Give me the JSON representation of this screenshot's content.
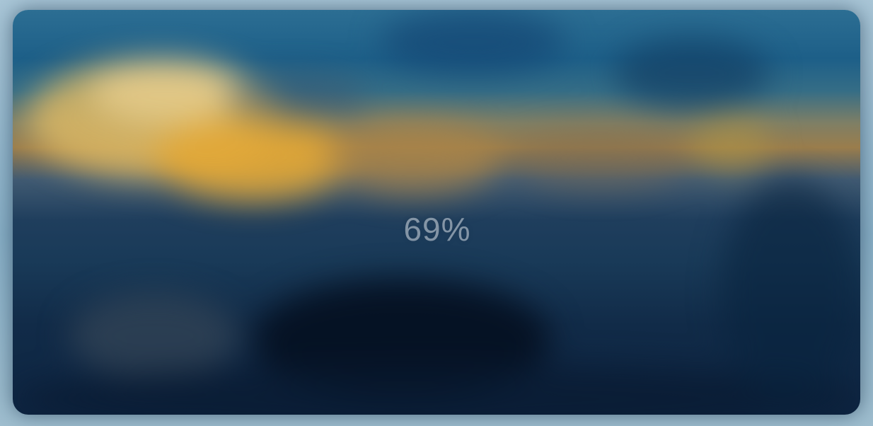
{
  "loader": {
    "progress_label": "69%",
    "progress_value": 69
  },
  "colors": {
    "text": "#c4cdd6",
    "sky": "#1d5f88",
    "glow": "#e3a836",
    "sea": "#0e2542"
  }
}
